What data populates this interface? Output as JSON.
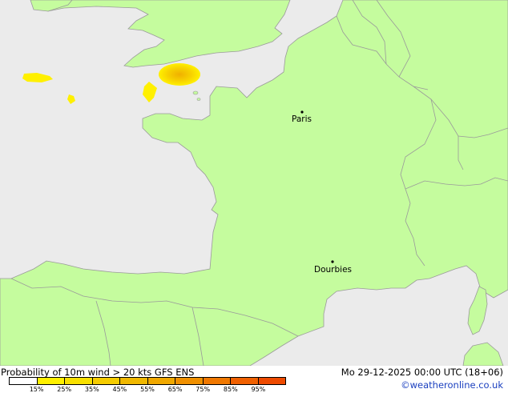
{
  "map": {
    "cities": [
      {
        "name": "Paris"
      },
      {
        "name": "Dourbies"
      }
    ],
    "colors": {
      "sea": "#ebebeb",
      "land": "#c5fc9e",
      "border": "#9a9a9a",
      "prob_low": "#fff000",
      "prob_mid": "#f5c400"
    }
  },
  "footer": {
    "product_title": "Probability of 10m wind > 20 kts GFS ENS",
    "valid_time": "Mo 29-12-2025 00:00 UTC (18+06)",
    "credit": "©weatheronline.co.uk"
  },
  "legend": {
    "swatch_colors": [
      "#ffffff",
      "#fff000",
      "#f8e000",
      "#f5cc00",
      "#f0b800",
      "#f0a800",
      "#f09000",
      "#f07800",
      "#f06000",
      "#ee4a00"
    ],
    "tick_labels": [
      "15%",
      "25%",
      "35%",
      "45%",
      "55%",
      "65%",
      "75%",
      "85%",
      "95%"
    ]
  }
}
